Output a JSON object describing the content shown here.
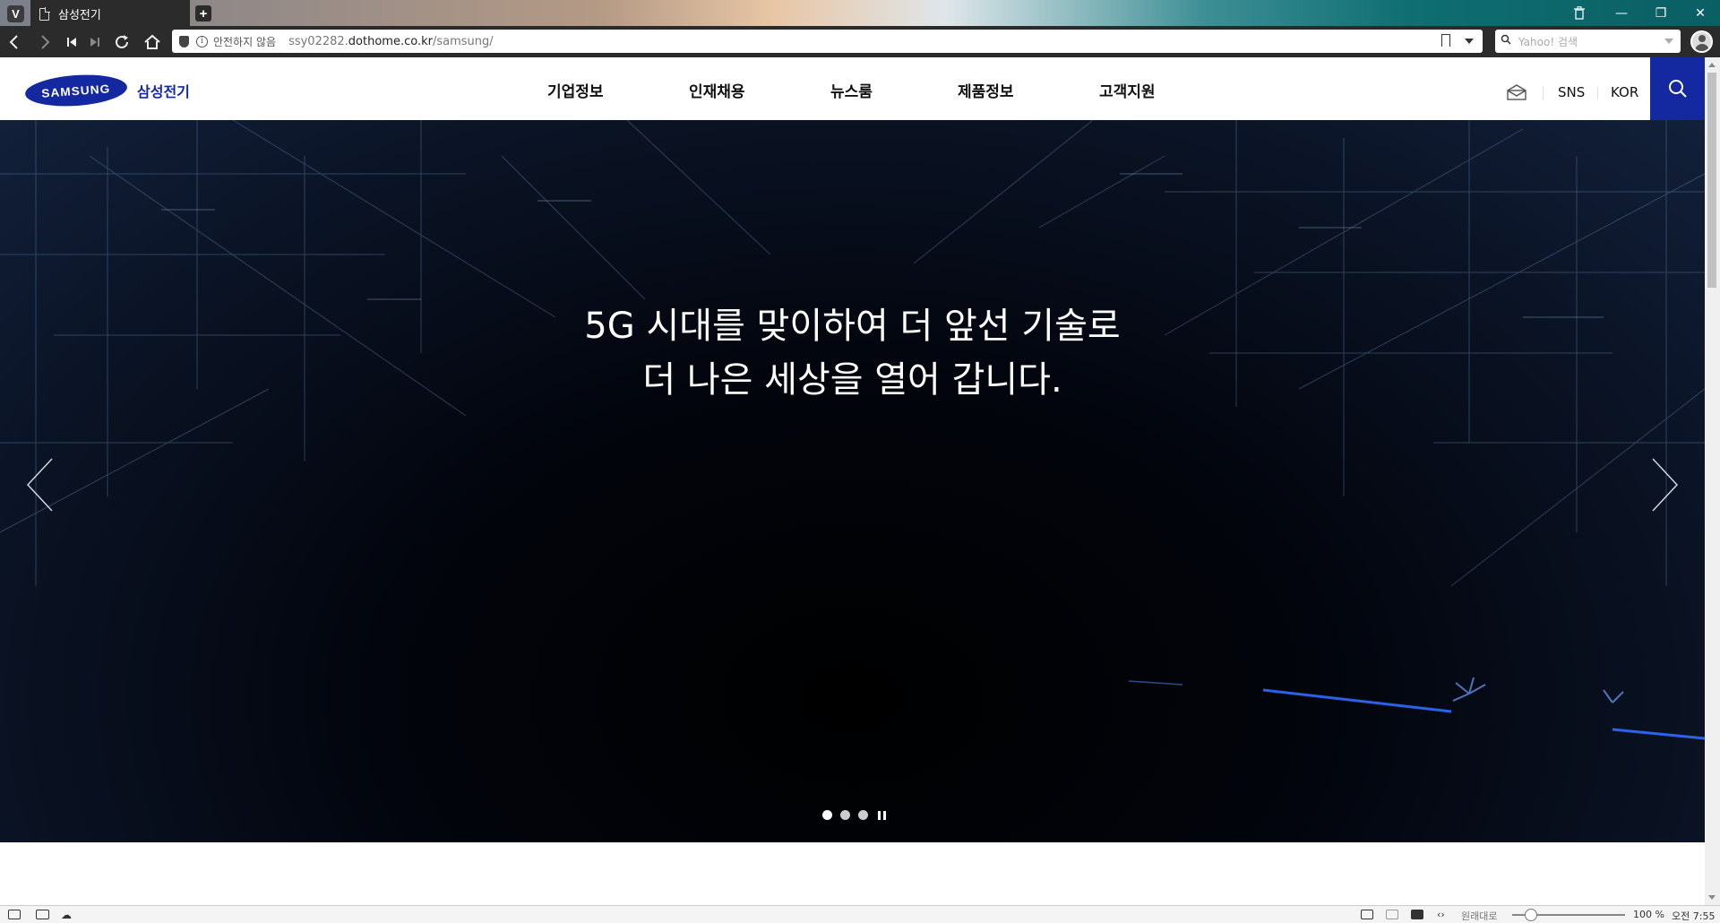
{
  "browser": {
    "tab_title": "삼성전기",
    "new_tab_symbol": "+",
    "logo_letter": "V",
    "security_label": "안전하지 않음",
    "url_prefix": "ssy02282.",
    "url_domain": "dothome.co.kr",
    "url_path": "/samsung/",
    "search_placeholder": "Yahoo! 검색",
    "window_controls": [
      "—",
      "❐",
      "✕"
    ]
  },
  "site": {
    "logo_text": "SAMSUNG",
    "logo_kr": "삼성전기",
    "nav": [
      "기업정보",
      "인재채용",
      "뉴스룸",
      "제품정보",
      "고객지원"
    ],
    "util": {
      "sns": "SNS",
      "lang": "KOR"
    }
  },
  "hero": {
    "line1": "5G 시대를 맞이하여 더 앞선 기술로",
    "line2": "더 나은 세상을 열어 갑니다.",
    "slide_count": 3,
    "active_slide": 1
  },
  "statusbar": {
    "image_mode": "원래대로",
    "zoom": "100 %",
    "time": "오전 7:55"
  },
  "colors": {
    "brand": "#1428a0",
    "hero_bg": "#0b1426",
    "chrome": "#2b2b2b"
  }
}
